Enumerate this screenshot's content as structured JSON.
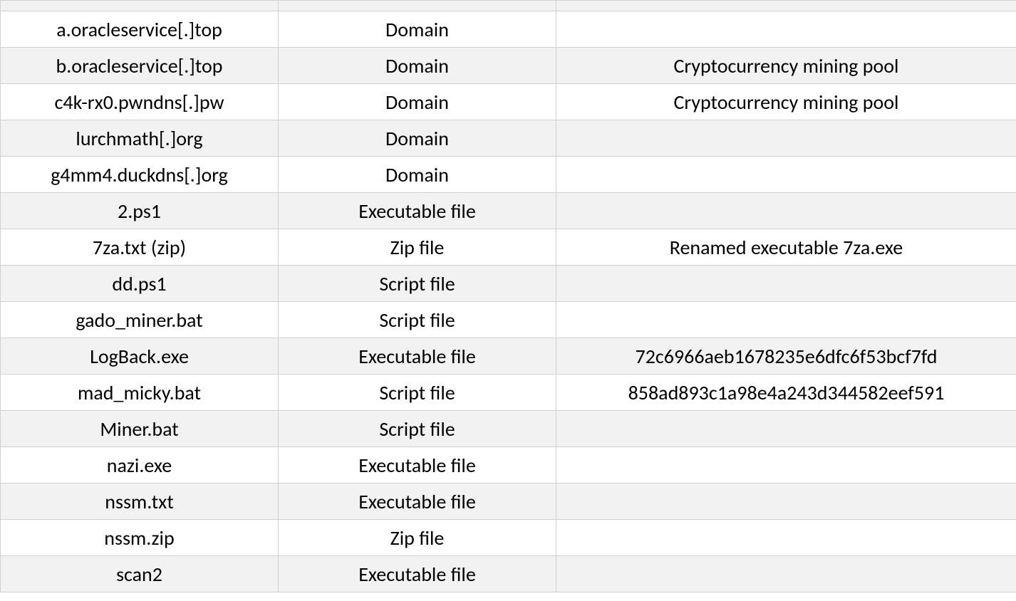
{
  "table": {
    "rows": [
      {
        "c1": "a.oracleservice[.]top",
        "c2": "Domain",
        "c3": ""
      },
      {
        "c1": "b.oracleservice[.]top",
        "c2": "Domain",
        "c3": "Cryptocurrency mining pool"
      },
      {
        "c1": "c4k-rx0.pwndns[.]pw",
        "c2": "Domain",
        "c3": "Cryptocurrency mining pool"
      },
      {
        "c1": "lurchmath[.]org",
        "c2": "Domain",
        "c3": ""
      },
      {
        "c1": "g4mm4.duckdns[.]org",
        "c2": "Domain",
        "c3": ""
      },
      {
        "c1": "2.ps1",
        "c2": "Executable file",
        "c3": ""
      },
      {
        "c1": "7za.txt (zip)",
        "c2": "Zip file",
        "c3": "Renamed executable 7za.exe"
      },
      {
        "c1": "dd.ps1",
        "c2": "Script file",
        "c3": ""
      },
      {
        "c1": "gado_miner.bat",
        "c2": "Script file",
        "c3": ""
      },
      {
        "c1": "LogBack.exe",
        "c2": "Executable file",
        "c3": "72c6966aeb1678235e6dfc6f53bcf7fd"
      },
      {
        "c1": "mad_micky.bat",
        "c2": "Script file",
        "c3": "858ad893c1a98e4a243d344582eef591"
      },
      {
        "c1": "Miner.bat",
        "c2": "Script file",
        "c3": ""
      },
      {
        "c1": "nazi.exe",
        "c2": "Executable file",
        "c3": ""
      },
      {
        "c1": "nssm.txt",
        "c2": "Executable file",
        "c3": ""
      },
      {
        "c1": "nssm.zip",
        "c2": "Zip file",
        "c3": ""
      },
      {
        "c1": "scan2",
        "c2": "Executable file",
        "c3": ""
      }
    ]
  }
}
